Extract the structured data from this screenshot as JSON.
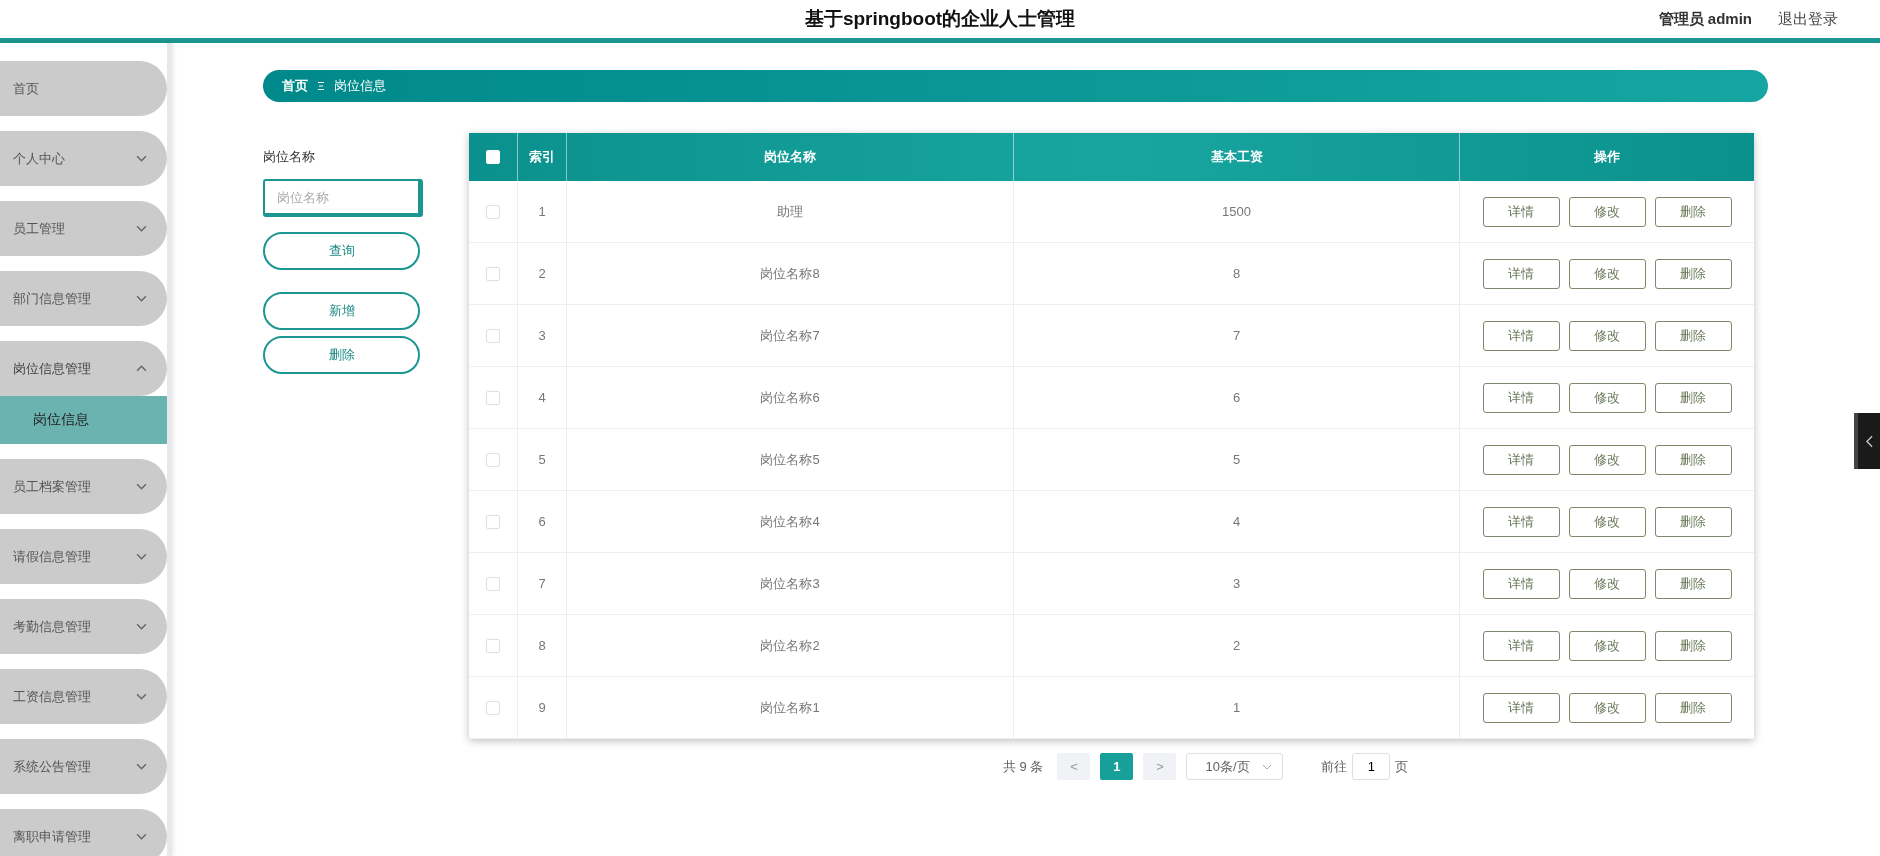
{
  "header": {
    "title": "基于springboot的企业人士管理",
    "user": "管理员 admin",
    "logout": "退出登录"
  },
  "sidebar": {
    "items": [
      {
        "label": "首页",
        "kind": "link"
      },
      {
        "label": "个人中心",
        "kind": "group",
        "expanded": false
      },
      {
        "label": "员工管理",
        "kind": "group",
        "expanded": false
      },
      {
        "label": "部门信息管理",
        "kind": "group",
        "expanded": false
      },
      {
        "label": "岗位信息管理",
        "kind": "group",
        "expanded": true,
        "children": [
          {
            "label": "岗位信息",
            "selected": true
          }
        ]
      },
      {
        "label": "员工档案管理",
        "kind": "group",
        "expanded": false
      },
      {
        "label": "请假信息管理",
        "kind": "group",
        "expanded": false
      },
      {
        "label": "考勤信息管理",
        "kind": "group",
        "expanded": false
      },
      {
        "label": "工资信息管理",
        "kind": "group",
        "expanded": false
      },
      {
        "label": "系统公告管理",
        "kind": "group",
        "expanded": false
      },
      {
        "label": "离职申请管理",
        "kind": "group",
        "expanded": false
      }
    ]
  },
  "breadcrumb": [
    "首页",
    "岗位信息"
  ],
  "search": {
    "label": "岗位名称",
    "placeholder": "岗位名称",
    "buttons": [
      "查询",
      "新增",
      "删除"
    ]
  },
  "table": {
    "select_all_checked": false,
    "columns": [
      "索引",
      "岗位名称",
      "基本工资",
      "操作"
    ],
    "rows": [
      {
        "index": "1",
        "name": "助理",
        "salary": "1500",
        "checked": false,
        "actions": [
          "详情",
          "修改",
          "删除"
        ]
      },
      {
        "index": "2",
        "name": "岗位名称8",
        "salary": "8",
        "checked": false,
        "actions": [
          "详情",
          "修改",
          "删除"
        ]
      },
      {
        "index": "3",
        "name": "岗位名称7",
        "salary": "7",
        "checked": false,
        "actions": [
          "详情",
          "修改",
          "删除"
        ]
      },
      {
        "index": "4",
        "name": "岗位名称6",
        "salary": "6",
        "checked": false,
        "actions": [
          "详情",
          "修改",
          "删除"
        ]
      },
      {
        "index": "5",
        "name": "岗位名称5",
        "salary": "5",
        "checked": false,
        "actions": [
          "详情",
          "修改",
          "删除"
        ]
      },
      {
        "index": "6",
        "name": "岗位名称4",
        "salary": "4",
        "checked": false,
        "actions": [
          "详情",
          "修改",
          "删除"
        ]
      },
      {
        "index": "7",
        "name": "岗位名称3",
        "salary": "3",
        "checked": false,
        "actions": [
          "详情",
          "修改",
          "删除"
        ]
      },
      {
        "index": "8",
        "name": "岗位名称2",
        "salary": "2",
        "checked": false,
        "actions": [
          "详情",
          "修改",
          "删除"
        ]
      },
      {
        "index": "9",
        "name": "岗位名称1",
        "salary": "1",
        "checked": false,
        "actions": [
          "详情",
          "修改",
          "删除"
        ]
      }
    ]
  },
  "pagination": {
    "total": "共 9 条",
    "prev": "<",
    "pages": [
      {
        "label": "1",
        "selected": true
      }
    ],
    "next": ">",
    "page_size": "10条/页",
    "goto_label": "前往",
    "goto_value": "1",
    "goto_suffix": "页"
  }
}
